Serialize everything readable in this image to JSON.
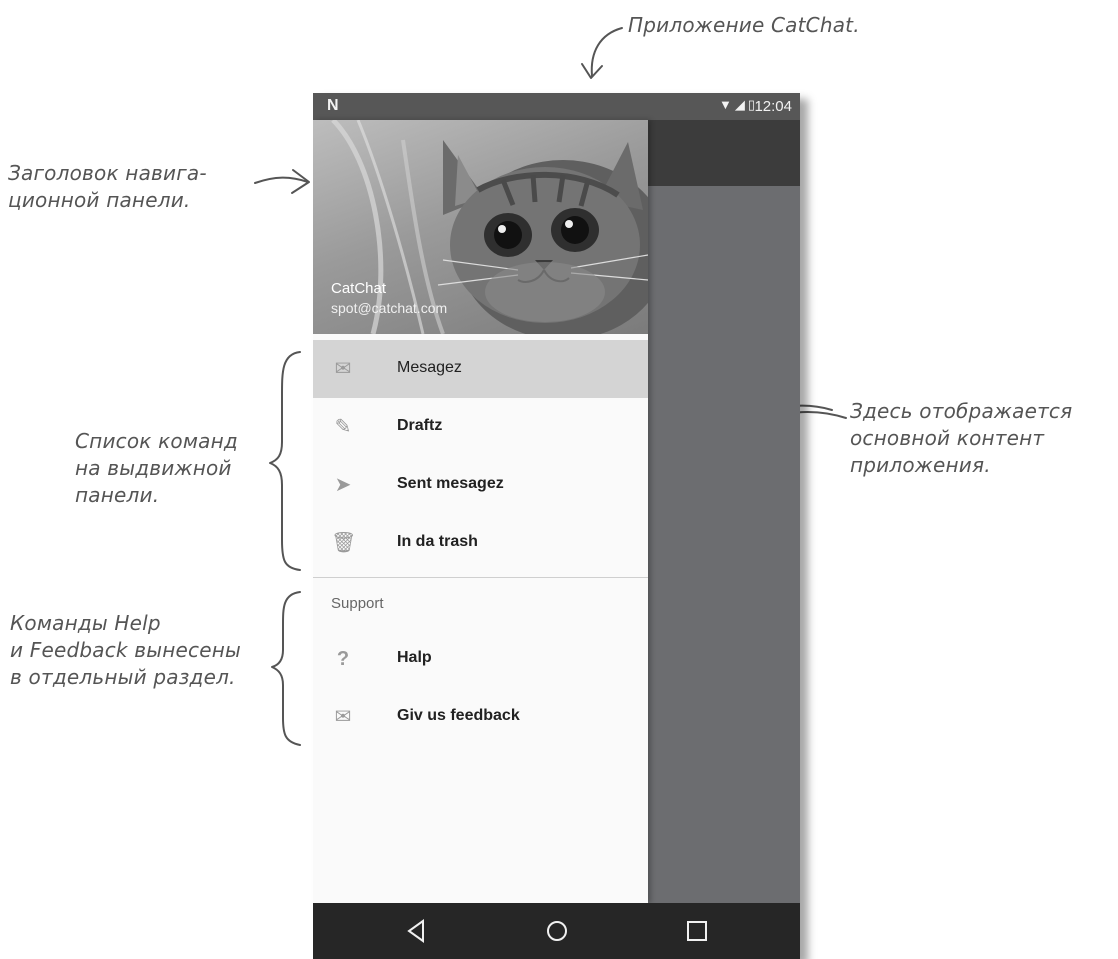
{
  "annotations": {
    "app": "Приложение CatChat.",
    "header": [
      "Заголовок навига-",
      "ционной панели."
    ],
    "list": [
      "Список команд",
      "на выдвижной",
      "панели."
    ],
    "support": [
      "Команды Help",
      "и Feedback вынесены",
      "в отдельный раздел."
    ],
    "content": [
      "Здесь отображается",
      "основной контент",
      "приложения."
    ]
  },
  "statusbar": {
    "logo": "N",
    "icons": "▼◢▯",
    "time": "12:04"
  },
  "drawer": {
    "header": {
      "title": "CatChat",
      "email": "spot@catchat.com"
    },
    "items": [
      {
        "label": "Mesagez",
        "icon": "envelope-icon",
        "glyph": "✉",
        "selected": true
      },
      {
        "label": "Draftz",
        "icon": "pencil-icon",
        "glyph": "✎",
        "selected": false
      },
      {
        "label": "Sent mesagez",
        "icon": "send-icon",
        "glyph": "➤",
        "selected": false
      },
      {
        "label": "In da trash",
        "icon": "trash-icon",
        "glyph": "🗑",
        "selected": false
      }
    ],
    "support": {
      "title": "Support",
      "items": [
        {
          "label": "Halp",
          "icon": "help-icon",
          "glyph": "?"
        },
        {
          "label": "Giv us feedback",
          "icon": "envelope-icon",
          "glyph": "✉"
        }
      ]
    }
  },
  "colors": {
    "statusbar": "#575757",
    "toolbar": "#3c3c3c",
    "content": "#6c6d70",
    "selected": "#d4d4d4",
    "navbar": "#262626"
  }
}
